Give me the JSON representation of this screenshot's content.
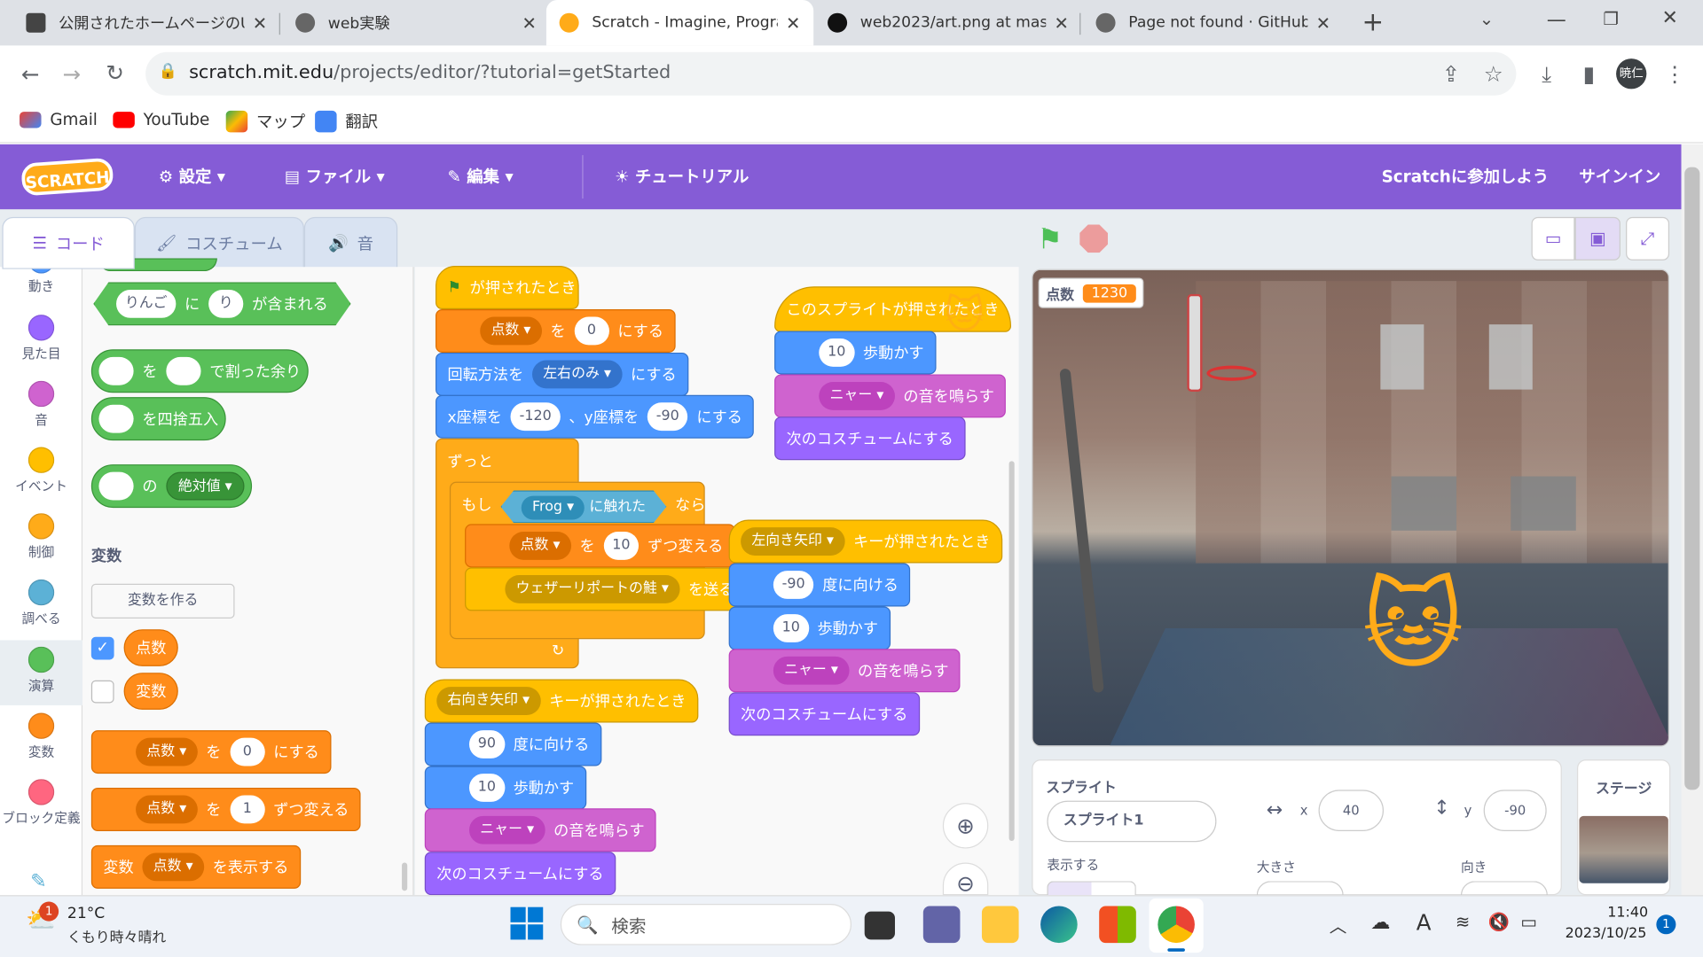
{
  "browser": {
    "tabs": [
      {
        "title": "公開されたホームページのUR",
        "icon": "document-icon"
      },
      {
        "title": "web実験",
        "icon": "globe-icon"
      },
      {
        "title": "Scratch - Imagine, Progra",
        "icon": "scratch-icon",
        "active": true
      },
      {
        "title": "web2023/art.png at mas",
        "icon": "github-icon"
      },
      {
        "title": "Page not found · GitHub",
        "icon": "globe-icon"
      }
    ],
    "url_host": "scratch.mit.edu",
    "url_path": "/projects/editor/?tutorial=getStarted",
    "profile": "暁仁",
    "bookmarks": [
      "Gmail",
      "YouTube",
      "マップ",
      "翻訳"
    ]
  },
  "menu": {
    "logo": "SCRATCH",
    "settings": "設定",
    "file": "ファイル",
    "edit": "編集",
    "tutorials": "チュートリアル",
    "join": "Scratchに参加しよう",
    "signin": "サインイン"
  },
  "editor_tabs": {
    "code": "コード",
    "costumes": "コスチューム",
    "sounds": "音"
  },
  "categories": [
    {
      "label": "動き",
      "color": "#4c97ff"
    },
    {
      "label": "見た目",
      "color": "#9966ff"
    },
    {
      "label": "音",
      "color": "#cf63cf"
    },
    {
      "label": "イベント",
      "color": "#ffbf00"
    },
    {
      "label": "制御",
      "color": "#ffab19"
    },
    {
      "label": "調べる",
      "color": "#5cb1d6"
    },
    {
      "label": "演算",
      "color": "#59c059"
    },
    {
      "label": "変数",
      "color": "#ff8c1a"
    },
    {
      "label": "ブロック定義",
      "color": "#ff6680"
    }
  ],
  "palette": {
    "contains": {
      "a": "りんご",
      "mid": "に",
      "b": "り",
      "tail": "が含まれる"
    },
    "mod": {
      "mid": "を",
      "tail": "で割った余り"
    },
    "round": "を四捨五入",
    "abs": {
      "mid": "の",
      "op": "絶対値"
    },
    "variables_heading": "変数",
    "make_variable": "変数を作る",
    "var1": "点数",
    "var2": "変数",
    "set": {
      "var": "点数",
      "mid": "を",
      "value": "0",
      "tail": "にする"
    },
    "change": {
      "var": "点数",
      "mid": "を",
      "value": "1",
      "tail": "ずつ変える"
    },
    "show": {
      "head": "変数",
      "var": "点数",
      "tail": "を表示する"
    }
  },
  "script1": {
    "flag": "が押されたとき",
    "set": {
      "var": "点数",
      "mid": "を",
      "value": "0",
      "tail": "にする"
    },
    "rotation": {
      "head": "回転方法を",
      "opt": "左右のみ",
      "tail": "にする"
    },
    "goto": {
      "x_label": "x座標を",
      "x": "-120",
      "y_label": "、y座標を",
      "y": "-90",
      "tail": "にする"
    },
    "forever": "ずっと",
    "if": {
      "head": "もし",
      "sprite": "Frog",
      "touch": "に触れた",
      "tail": "なら"
    },
    "change": {
      "var": "点数",
      "mid": "を",
      "value": "10",
      "tail": "ずつ変える"
    },
    "broadcast": {
      "msg": "ウェザーリポートの鮭",
      "tail": "を送る"
    }
  },
  "script2": {
    "hat": {
      "key": "右向き矢印",
      "tail": "キーが押されたとき"
    },
    "point": {
      "value": "90",
      "tail": "度に向ける"
    },
    "move": {
      "value": "10",
      "tail": "歩動かす"
    },
    "sound": {
      "snd": "ニャー",
      "tail": "の音を鳴らす"
    },
    "costume": "次のコスチュームにする"
  },
  "script3": {
    "hat": "このスプライトが押されたとき",
    "move": {
      "value": "10",
      "tail": "歩動かす"
    },
    "sound": {
      "snd": "ニャー",
      "tail": "の音を鳴らす"
    },
    "costume": "次のコスチュームにする"
  },
  "script4": {
    "hat": {
      "key": "左向き矢印",
      "tail": "キーが押されたとき"
    },
    "point": {
      "value": "-90",
      "tail": "度に向ける"
    },
    "move": {
      "value": "10",
      "tail": "歩動かす"
    },
    "sound": {
      "snd": "ニャー",
      "tail": "の音を鳴らす"
    },
    "costume": "次のコスチュームにする"
  },
  "stage": {
    "monitor_label": "点数",
    "monitor_value": "1230"
  },
  "sprite_panel": {
    "heading": "スプライト",
    "name": "スプライト1",
    "x_label": "x",
    "x": "40",
    "y_label": "y",
    "y": "-90",
    "show_label": "表示する",
    "size_label": "大きさ",
    "direction_label": "向き"
  },
  "stage_panel": {
    "heading": "ステージ"
  },
  "taskbar": {
    "weather_temp": "21°C",
    "weather_desc": "くもり時々晴れ",
    "weather_badge": "1",
    "search": "検索",
    "time": "11:40",
    "date": "2023/10/25",
    "notif": "1"
  }
}
